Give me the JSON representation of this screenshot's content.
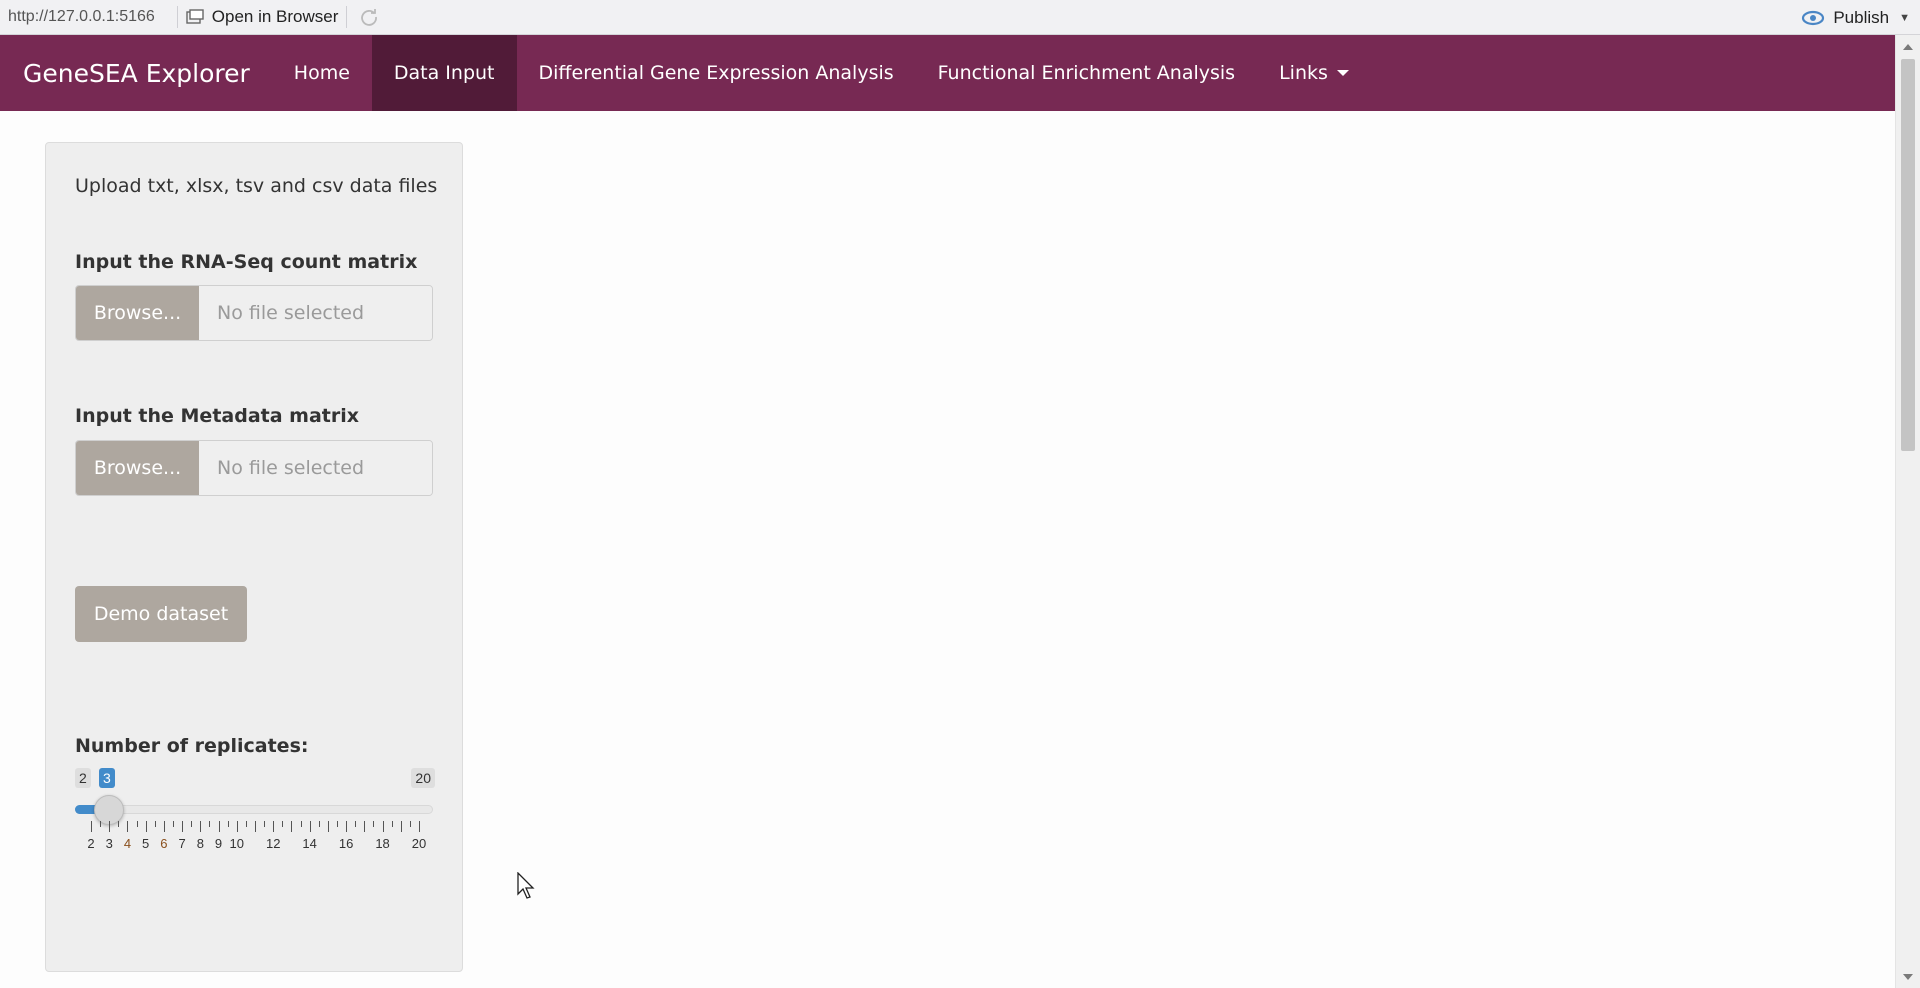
{
  "chrome": {
    "url": "http://127.0.0.1:5166",
    "open_in_browser": "Open in Browser",
    "publish": "Publish"
  },
  "navbar": {
    "brand": "GeneSEA Explorer",
    "items": [
      {
        "label": "Home"
      },
      {
        "label": "Data Input",
        "active": true
      },
      {
        "label": "Differential Gene Expression Analysis"
      },
      {
        "label": "Functional Enrichment Analysis"
      },
      {
        "label": "Links"
      }
    ]
  },
  "sidebar": {
    "help_text": "Upload txt, xlsx, tsv and csv data files",
    "count_matrix": {
      "label": "Input the RNA-Seq count matrix",
      "browse": "Browse...",
      "placeholder": "No file selected"
    },
    "metadata_matrix": {
      "label": "Input the Metadata matrix",
      "browse": "Browse...",
      "placeholder": "No file selected"
    },
    "demo_button": "Demo dataset",
    "replicates": {
      "label": "Number of replicates:",
      "min": "2",
      "max": "20",
      "value": "3",
      "tick_labels": [
        "2",
        "3",
        "4",
        "5",
        "6",
        "7",
        "8",
        "9",
        "10",
        "12",
        "14",
        "16",
        "18",
        "20"
      ]
    }
  },
  "colors": {
    "navbar": "#772953",
    "navbar_active": "#511b38",
    "button": "#aea79f",
    "slider_accent": "#428bca"
  }
}
